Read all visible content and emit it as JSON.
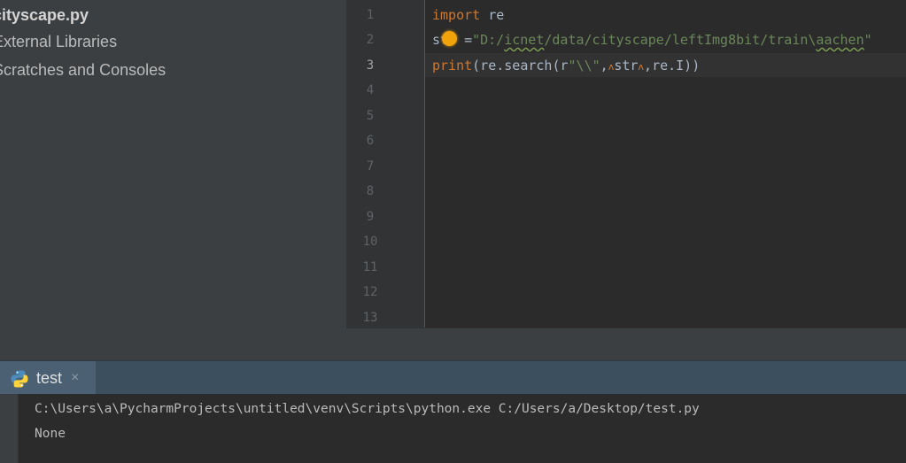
{
  "project_tree": {
    "items": [
      {
        "label": "cityscape.py"
      },
      {
        "label": "External Libraries"
      },
      {
        "label": "Scratches and Consoles"
      }
    ]
  },
  "editor": {
    "line_numbers": [
      "1",
      "2",
      "3",
      "4",
      "5",
      "6",
      "7",
      "8",
      "9",
      "10",
      "11",
      "12",
      "13"
    ],
    "current_line": "3",
    "code": {
      "l1_kw": "import",
      "l1_rest": " re",
      "l2_a": "st",
      "l2_b": "=",
      "l2_str_a": "\"D:/",
      "l2_str_b": "icnet",
      "l2_str_c": "/data/cityscape/leftImg8bit/train\\",
      "l2_str_d": "aachen",
      "l2_str_e": "\"",
      "l3_fn": "print",
      "l3_a": "(re.search(r",
      "l3_str": "\"\\\\\"",
      "l3_b": ",",
      "l3_c": "str",
      "l3_d": ",",
      "l3_e": "re.I))",
      "space_hint": "ʌ"
    }
  },
  "run_panel": {
    "tab_label": "test",
    "close_glyph": "×",
    "console_lines": [
      "C:\\Users\\a\\PycharmProjects\\untitled\\venv\\Scripts\\python.exe C:/Users/a/Desktop/test.py",
      "None"
    ]
  },
  "colors": {
    "keyword": "#cc7832",
    "string": "#6a8759",
    "text": "#a9b7c6",
    "background": "#2b2b2b"
  },
  "icons": {
    "intention": "lightbulb-icon",
    "run_tab": "python-icon"
  }
}
